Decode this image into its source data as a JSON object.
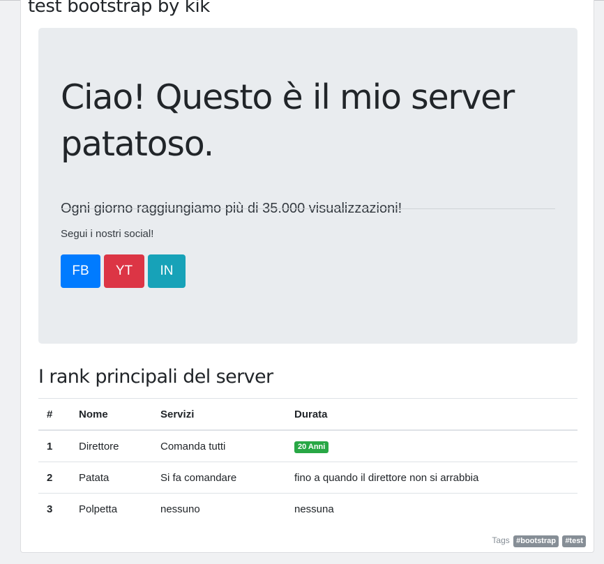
{
  "post": {
    "title": "test bootstrap by kik"
  },
  "jumbotron": {
    "heading": "Ciao! Questo è il mio server patatoso.",
    "lead": "Ogni giorno raggiungiamo più di 35.000 visualizzazioni!",
    "social_text": "Segui i nostri social!",
    "buttons": [
      {
        "label": "FB",
        "color": "#007bff"
      },
      {
        "label": "YT",
        "color": "#dc3545"
      },
      {
        "label": "IN",
        "color": "#17a2b8"
      }
    ]
  },
  "ranks": {
    "title": "I rank principali del server",
    "columns": [
      "#",
      "Nome",
      "Servizi",
      "Durata"
    ],
    "rows": [
      {
        "num": "1",
        "nome": "Direttore",
        "servizi": "Comanda tutti",
        "durata": "20 Anni",
        "durata_badge": true
      },
      {
        "num": "2",
        "nome": "Patata",
        "servizi": "Si fa comandare",
        "durata": "fino a quando il direttore non si arrabbia"
      },
      {
        "num": "3",
        "nome": "Polpetta",
        "servizi": "nessuno",
        "durata": "nessuna"
      }
    ]
  },
  "footer": {
    "tags_label": "Tags",
    "tags": [
      "#bootstrap",
      "#test"
    ]
  },
  "colors": {
    "badge_success": "#28a745",
    "tag_gray": "#868e96",
    "jumbotron_bg": "#e9ecef"
  }
}
